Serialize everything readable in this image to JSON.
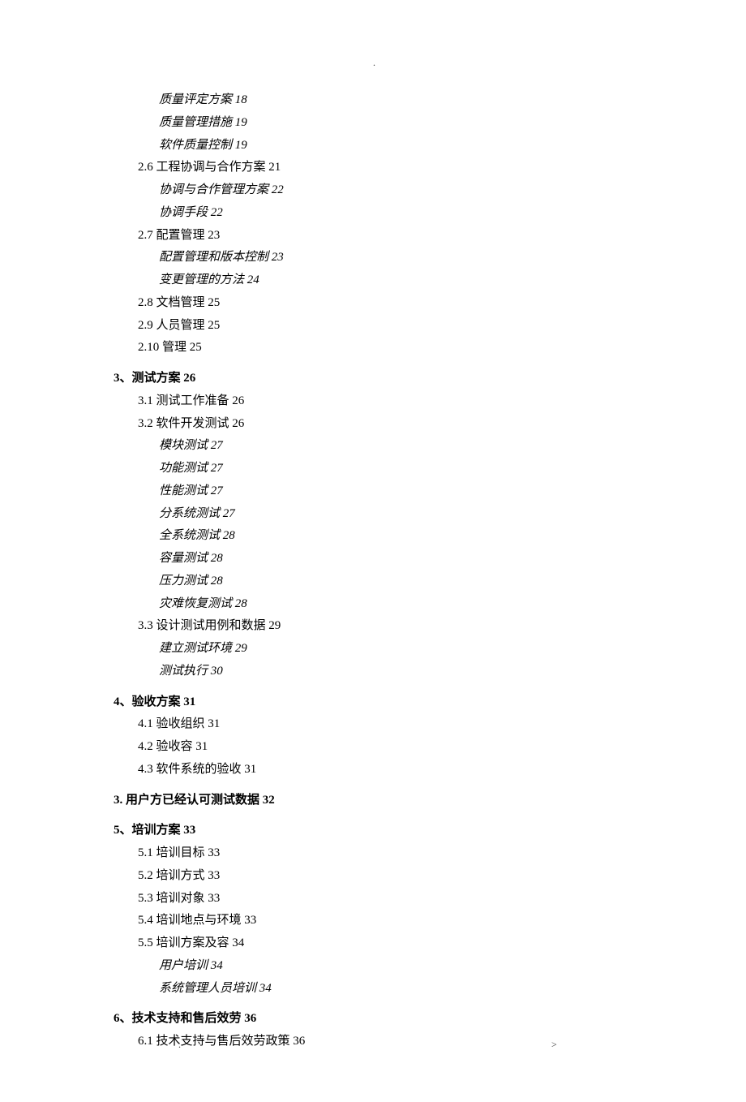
{
  "marks": {
    "topDot": ".",
    "bottomLeftDot": ".",
    "bottomRightAngle": ">"
  },
  "lines": [
    {
      "text": "质量评定方案 18",
      "cls": "indent-2 italic"
    },
    {
      "text": "质量管理措施 19",
      "cls": "indent-2 italic"
    },
    {
      "text": "软件质量控制 19",
      "cls": "indent-2 italic"
    },
    {
      "text": "2.6 工程协调与合作方案 21",
      "cls": "indent-1"
    },
    {
      "text": "协调与合作管理方案 22",
      "cls": "indent-2 italic"
    },
    {
      "text": "协调手段 22",
      "cls": "indent-2 italic"
    },
    {
      "text": "2.7 配置管理 23",
      "cls": "indent-1"
    },
    {
      "text": "配置管理和版本控制 23",
      "cls": "indent-2 italic"
    },
    {
      "text": "变更管理的方法 24",
      "cls": "indent-2 italic"
    },
    {
      "text": "2.8 文档管理 25",
      "cls": "indent-1"
    },
    {
      "text": "2.9 人员管理 25",
      "cls": "indent-1"
    },
    {
      "text": "2.10 管理 25",
      "cls": "indent-1"
    },
    {
      "text": "3、测试方案 26",
      "cls": "bold section-gap"
    },
    {
      "text": "3.1 测试工作准备 26",
      "cls": "indent-1"
    },
    {
      "text": "3.2 软件开发测试 26",
      "cls": "indent-1"
    },
    {
      "text": "模块测试 27",
      "cls": "indent-2 italic"
    },
    {
      "text": "功能测试 27",
      "cls": "indent-2 italic"
    },
    {
      "text": "性能测试 27",
      "cls": "indent-2 italic"
    },
    {
      "text": "分系统测试 27",
      "cls": "indent-2 italic"
    },
    {
      "text": "全系统测试 28",
      "cls": "indent-2 italic"
    },
    {
      "text": "容量测试 28",
      "cls": "indent-2 italic"
    },
    {
      "text": "压力测试 28",
      "cls": "indent-2 italic"
    },
    {
      "text": "灾难恢复测试 28",
      "cls": "indent-2 italic"
    },
    {
      "text": "3.3 设计测试用例和数据 29",
      "cls": "indent-1"
    },
    {
      "text": "建立测试环境 29",
      "cls": "indent-2 italic"
    },
    {
      "text": "测试执行 30",
      "cls": "indent-2 italic"
    },
    {
      "text": "4、验收方案 31",
      "cls": "bold section-gap"
    },
    {
      "text": "4.1 验收组织 31",
      "cls": "indent-1"
    },
    {
      "text": "4.2 验收容 31",
      "cls": "indent-1"
    },
    {
      "text": "4.3 软件系统的验收 31",
      "cls": "indent-1"
    },
    {
      "text": "3. 用户方已经认可测试数据 32",
      "cls": "bold section-gap"
    },
    {
      "text": "5、培训方案 33",
      "cls": "bold section-gap"
    },
    {
      "text": "5.1 培训目标 33",
      "cls": "indent-1"
    },
    {
      "text": "5.2 培训方式 33",
      "cls": "indent-1"
    },
    {
      "text": "5.3 培训对象 33",
      "cls": "indent-1"
    },
    {
      "text": "5.4 培训地点与环境 33",
      "cls": "indent-1"
    },
    {
      "text": "5.5 培训方案及容 34",
      "cls": "indent-1"
    },
    {
      "text": "用户培训 34",
      "cls": "indent-2 italic"
    },
    {
      "text": "系统管理人员培训 34",
      "cls": "indent-2 italic"
    },
    {
      "text": "6、技术支持和售后效劳 36",
      "cls": "bold section-gap"
    },
    {
      "text": "6.1 技术支持与售后效劳政策 36",
      "cls": "indent-1"
    }
  ]
}
